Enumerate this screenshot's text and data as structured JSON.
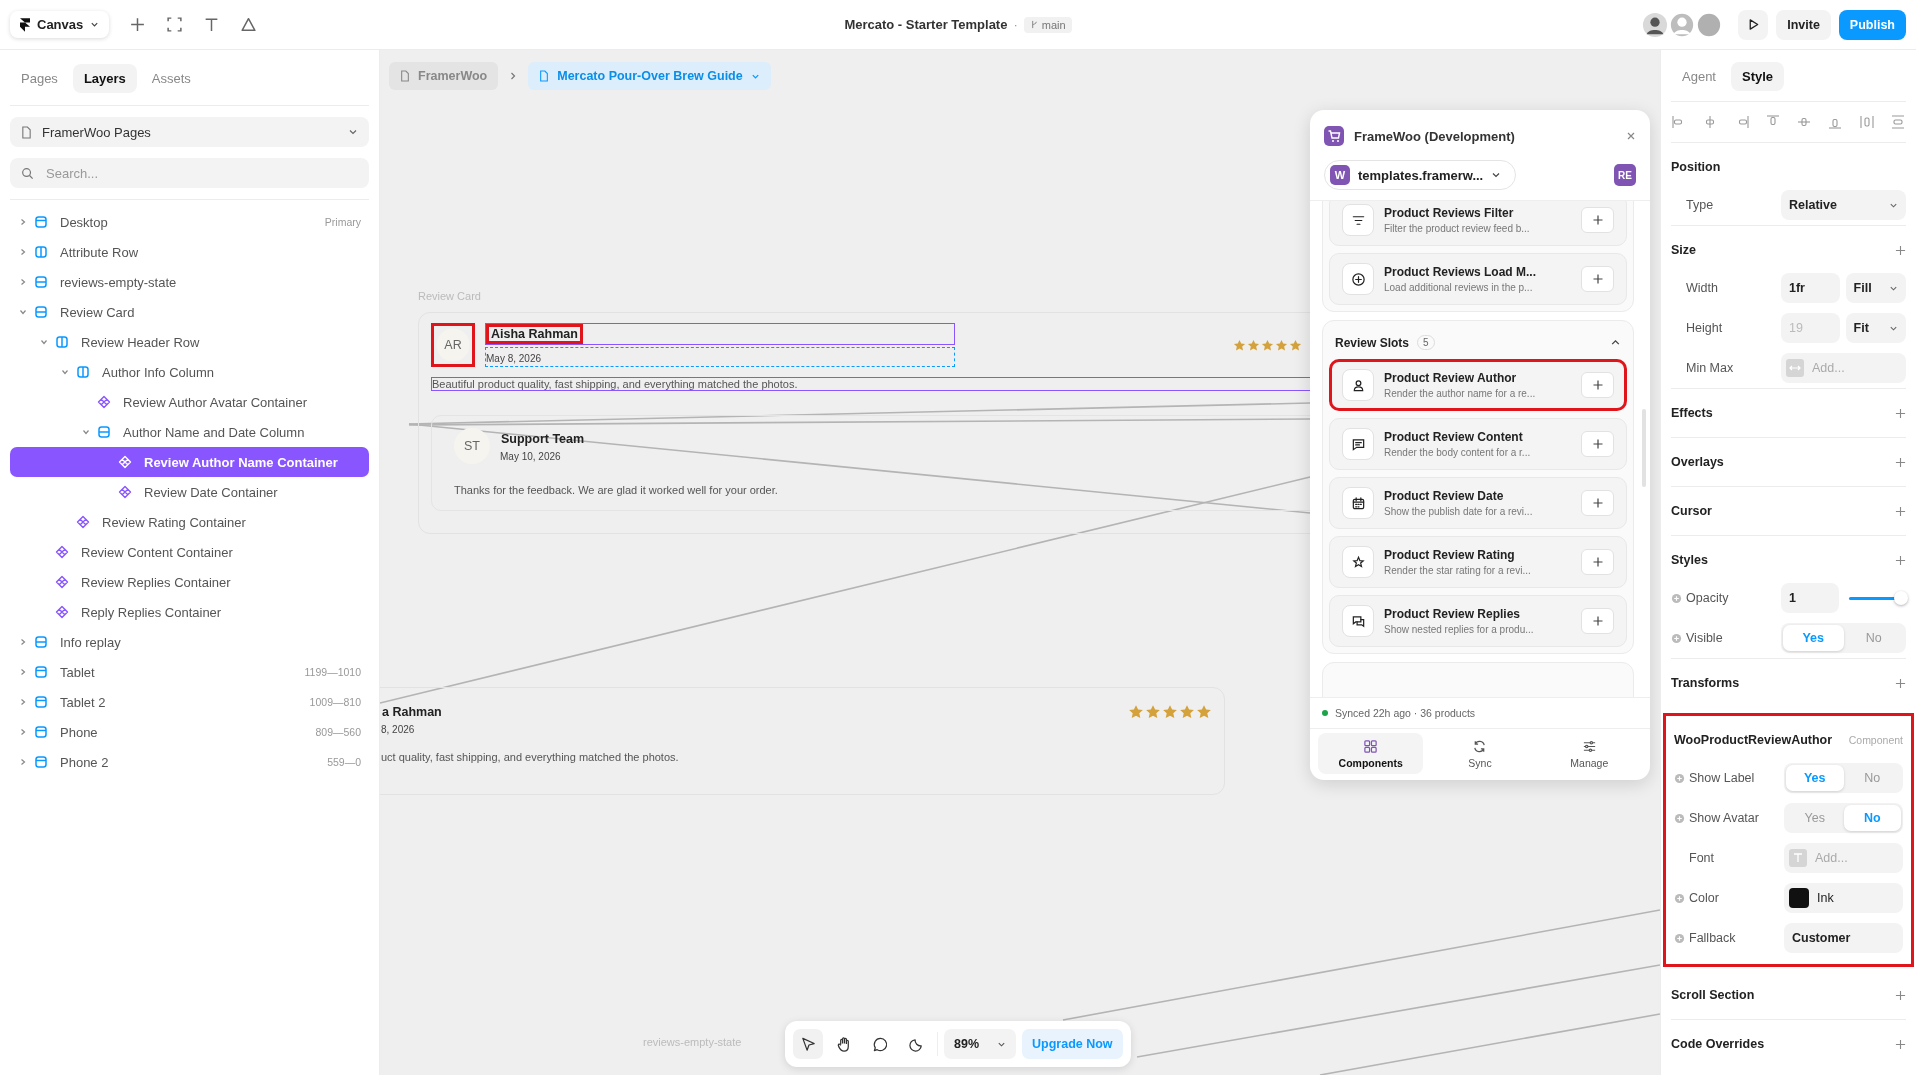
{
  "top_bar": {
    "menu": "Canvas",
    "title": "Mercato - Starter Template",
    "separator": "·",
    "branch": "main",
    "buttons": [
      {
        "label": "Invite",
        "kind": "secondary"
      },
      {
        "label": "Publish",
        "kind": "primary"
      }
    ]
  },
  "left_panel": {
    "tabs": [
      {
        "label": "Pages",
        "selected": false
      },
      {
        "label": "Layers",
        "selected": true
      },
      {
        "label": "Assets",
        "selected": false
      }
    ],
    "page_select": "FramerWoo Pages",
    "search": {
      "placeholder": "Search..."
    },
    "layers": [
      {
        "label": "Desktop",
        "kind": "frame",
        "meta": "Primary",
        "expanded": false,
        "selected": false
      },
      {
        "label": "Attribute Row",
        "kind": "row",
        "expanded": false,
        "selected": false
      },
      {
        "label": "reviews-empty-state",
        "kind": "column",
        "expanded": false,
        "selected": false
      },
      {
        "label": "Review Card",
        "kind": "column",
        "expanded": true,
        "selected": false,
        "children": [
          {
            "label": "Review Header Row",
            "kind": "row",
            "expanded": true,
            "selected": false,
            "children": [
              {
                "label": "Author Info Column",
                "kind": "row",
                "expanded": true,
                "selected": false,
                "children": [
                  {
                    "label": "Review Author Avatar Container",
                    "kind": "component",
                    "selected": false
                  },
                  {
                    "label": "Author Name and Date Column",
                    "kind": "column",
                    "expanded": true,
                    "selected": false,
                    "children": [
                      {
                        "label": "Review Author Name Container",
                        "kind": "component",
                        "selected": true
                      },
                      {
                        "label": "Review Date Container",
                        "kind": "component",
                        "selected": false
                      }
                    ]
                  }
                ]
              },
              {
                "label": "Review Rating Container",
                "kind": "component",
                "selected": false
              }
            ]
          },
          {
            "label": "Review Content Container",
            "kind": "component",
            "selected": false
          },
          {
            "label": "Review Replies Container",
            "kind": "component",
            "selected": false
          },
          {
            "label": "Reply Replies Container",
            "kind": "component",
            "selected": false
          }
        ]
      },
      {
        "label": "Info replay",
        "kind": "column",
        "expanded": false,
        "selected": false
      },
      {
        "label": "Tablet",
        "kind": "frame",
        "meta": "1199—1010",
        "expanded": false,
        "selected": false
      },
      {
        "label": "Tablet 2",
        "kind": "frame",
        "meta": "1009—810",
        "expanded": false,
        "selected": false
      },
      {
        "label": "Phone",
        "kind": "frame",
        "meta": "809—560",
        "expanded": false,
        "selected": false
      },
      {
        "label": "Phone 2",
        "kind": "frame",
        "meta": "559—0",
        "expanded": false,
        "selected": false
      }
    ]
  },
  "breadcrumb": [
    {
      "label": "FramerWoo",
      "selected": false
    },
    {
      "label": "Mercato Pour-Over Brew Guide",
      "selected": true
    }
  ],
  "canvas": {
    "frame_label": "Review Card",
    "review": {
      "initials": "AR",
      "author": "Aisha Rahman",
      "date": "May 8, 2026",
      "body": "Beautiful product quality, fast shipping, and everything matched the photos.",
      "stars": 5,
      "highlighted": true,
      "reply": {
        "initials": "ST",
        "author": "Support Team",
        "date": "May 10, 2026",
        "body": "Thanks for the feedback. We are glad it worked well for your order."
      }
    },
    "preview": {
      "author": "a Rahman",
      "date": "8, 2026",
      "body": "uct quality, fast shipping, and everything matched the photos.",
      "stars": 5
    },
    "empty_label": "reviews-empty-state",
    "toolbar": {
      "tools": [
        {
          "kind": "pointer",
          "selected": true
        },
        {
          "kind": "hand",
          "selected": false
        },
        {
          "kind": "comment",
          "selected": false
        },
        {
          "kind": "moon",
          "selected": false
        }
      ],
      "zoom": "89%",
      "upgrade": "Upgrade Now"
    }
  },
  "plugin": {
    "title": "FrameWoo (Development)",
    "site_badge": "W",
    "site": "templates.framerw...",
    "user": "RE",
    "items": [
      {
        "title": "Product Reviews Filter",
        "description": "Filter the product review feed b...",
        "highlighted": false
      },
      {
        "title": "Product Reviews Load M...",
        "description": "Load additional reviews in the p...",
        "highlighted": false
      }
    ],
    "section": {
      "title": "Review Slots",
      "count": "5",
      "expanded": true,
      "items": [
        {
          "title": "Product Review Author",
          "description": "Render the author name for a re...",
          "highlighted": true
        },
        {
          "title": "Product Review Content",
          "description": "Render the body content for a r...",
          "highlighted": false
        },
        {
          "title": "Product Review Date",
          "description": "Show the publish date for a revi...",
          "highlighted": false
        },
        {
          "title": "Product Review Rating",
          "description": "Render the star rating for a revi...",
          "highlighted": false
        },
        {
          "title": "Product Review Replies",
          "description": "Show nested replies for a produ...",
          "highlighted": false
        }
      ]
    },
    "status": "Synced 22h ago · 36 products",
    "tabs": [
      {
        "label": "Components",
        "selected": true
      },
      {
        "label": "Sync",
        "selected": false
      },
      {
        "label": "Manage",
        "selected": false
      }
    ]
  },
  "inspector": {
    "tabs": [
      {
        "label": "Agent",
        "selected": false
      },
      {
        "label": "Style",
        "selected": true
      }
    ],
    "position": {
      "title": "Position",
      "type_label": "Type",
      "type": "Relative"
    },
    "size": {
      "title": "Size",
      "rows": [
        {
          "label": "Width",
          "value": "1fr",
          "mode": "Fill",
          "disabled": false
        },
        {
          "label": "Height",
          "value": "19",
          "mode": "Fit",
          "disabled": true
        }
      ],
      "minmax_label": "Min Max",
      "minmax_placeholder": "Add..."
    },
    "sections_a": [
      "Effects",
      "Overlays",
      "Cursor"
    ],
    "styles": {
      "title": "Styles",
      "opacity_label": "Opacity",
      "opacity": "1",
      "level": 1,
      "visible_label": "Visible",
      "options": [
        {
          "label": "Yes",
          "selected": true
        },
        {
          "label": "No",
          "selected": false
        }
      ]
    },
    "transforms": "Transforms",
    "component": {
      "name": "WooProductReviewAuthor",
      "tag": "Component",
      "highlighted": true,
      "props": [
        {
          "kind": "toggle",
          "label": "Show Label",
          "addable": true,
          "options": [
            {
              "label": "Yes",
              "selected": true
            },
            {
              "label": "No",
              "selected": false
            }
          ]
        },
        {
          "kind": "toggle",
          "label": "Show Avatar",
          "addable": true,
          "options": [
            {
              "label": "Yes",
              "selected": false
            },
            {
              "label": "No",
              "selected": true
            }
          ]
        },
        {
          "kind": "font",
          "label": "Font",
          "addable": false,
          "placeholder": "Add..."
        },
        {
          "kind": "color",
          "label": "Color",
          "addable": true,
          "value": "Ink",
          "color": "#111111"
        },
        {
          "kind": "text",
          "label": "Fallback",
          "addable": true,
          "value": "Customer"
        }
      ]
    },
    "sections_b": [
      "Scroll Section",
      "Code Overrides"
    ]
  }
}
